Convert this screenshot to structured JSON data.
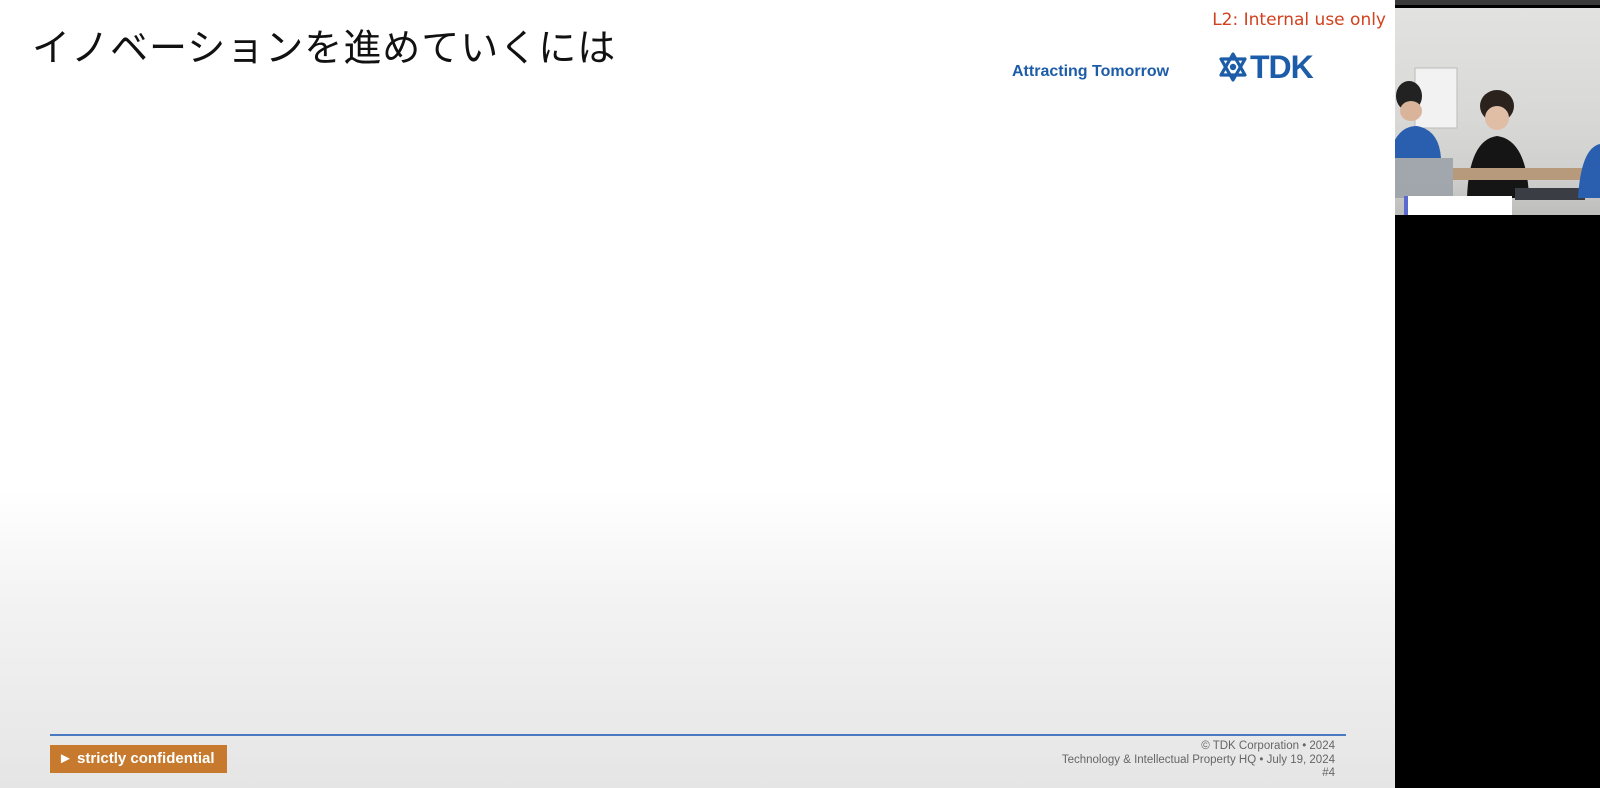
{
  "slide": {
    "title": "イノベーションを進めていくには",
    "internal_label": "L2: Internal use only",
    "tagline": "Attracting Tomorrow",
    "logo_text": "TDK",
    "confidential": "► strictly confidential",
    "footer": {
      "copyright": "© TDK Corporation • 2024",
      "department": "Technology & Intellectual Property HQ • July 19, 2024",
      "page_number": "#4"
    }
  },
  "colors": {
    "brand_blue": "#1d5ca8",
    "internal_label_red": "#d2401e",
    "confidential_orange": "#c77a2e",
    "footer_line": "#4a79c2"
  },
  "icons": {
    "logo_mark": "tdk-logo-mark-icon"
  }
}
